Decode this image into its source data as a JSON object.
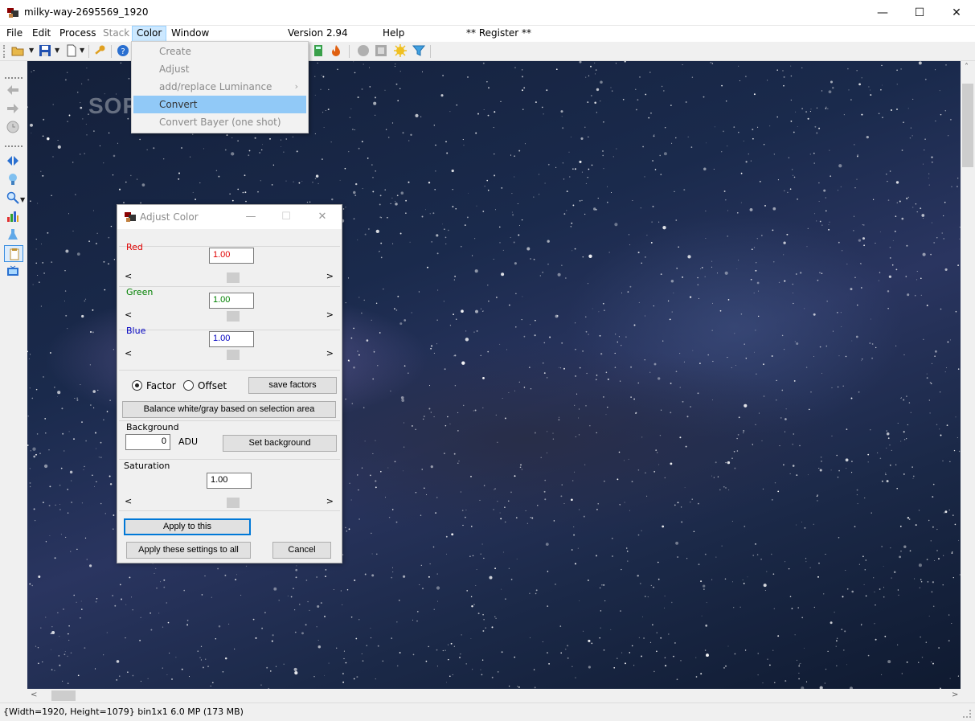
{
  "window": {
    "title": "milky-way-2695569_1920",
    "minimize_glyph": "—",
    "maximize_glyph": "☐",
    "close_glyph": "✕"
  },
  "menubar": {
    "items": [
      {
        "label": "File",
        "state": "normal"
      },
      {
        "label": "Edit",
        "state": "normal"
      },
      {
        "label": "Process",
        "state": "normal"
      },
      {
        "label": "Stack",
        "state": "disabled"
      },
      {
        "label": "Color",
        "state": "active"
      },
      {
        "label": "Window",
        "state": "normal"
      }
    ],
    "version": "Version 2.94",
    "help": "Help",
    "register": "** Register **"
  },
  "color_menu": {
    "items": [
      {
        "label": "Create",
        "highlighted": false
      },
      {
        "label": "Adjust",
        "highlighted": false
      },
      {
        "label": "add/replace Luminance",
        "highlighted": false,
        "submenu": true
      },
      {
        "label": "Convert",
        "highlighted": true
      },
      {
        "label": "Convert Bayer (one shot)",
        "highlighted": false
      }
    ],
    "submenu_glyph": "›"
  },
  "watermark": "SOFTPEDIA",
  "adjust_dialog": {
    "title": "Adjust Color",
    "channels": {
      "red": {
        "label": "Red",
        "value": "1.00",
        "color": "#e00000"
      },
      "green": {
        "label": "Green",
        "value": "1.00",
        "color": "#008000"
      },
      "blue": {
        "label": "Blue",
        "value": "1.00",
        "color": "#0000c0"
      }
    },
    "mode": {
      "factor": "Factor",
      "offset": "Offset",
      "selected": "factor"
    },
    "save_factors": "save factors",
    "balance": "Balance white/gray based on selection area",
    "background": {
      "label": "Background",
      "value": "0",
      "unit": "ADU",
      "button": "Set background"
    },
    "saturation": {
      "label": "Saturation",
      "value": "1.00"
    },
    "apply_this": "Apply to this",
    "apply_all": "Apply these settings to all",
    "cancel": "Cancel",
    "slider_left": "<",
    "slider_right": ">"
  },
  "statusbar": {
    "text": "{Width=1920, Height=1079} bin1x1  6.0 MP (173 MB)"
  },
  "scroll": {
    "left": "<",
    "right": ">",
    "up": "˄",
    "down": "˅"
  }
}
